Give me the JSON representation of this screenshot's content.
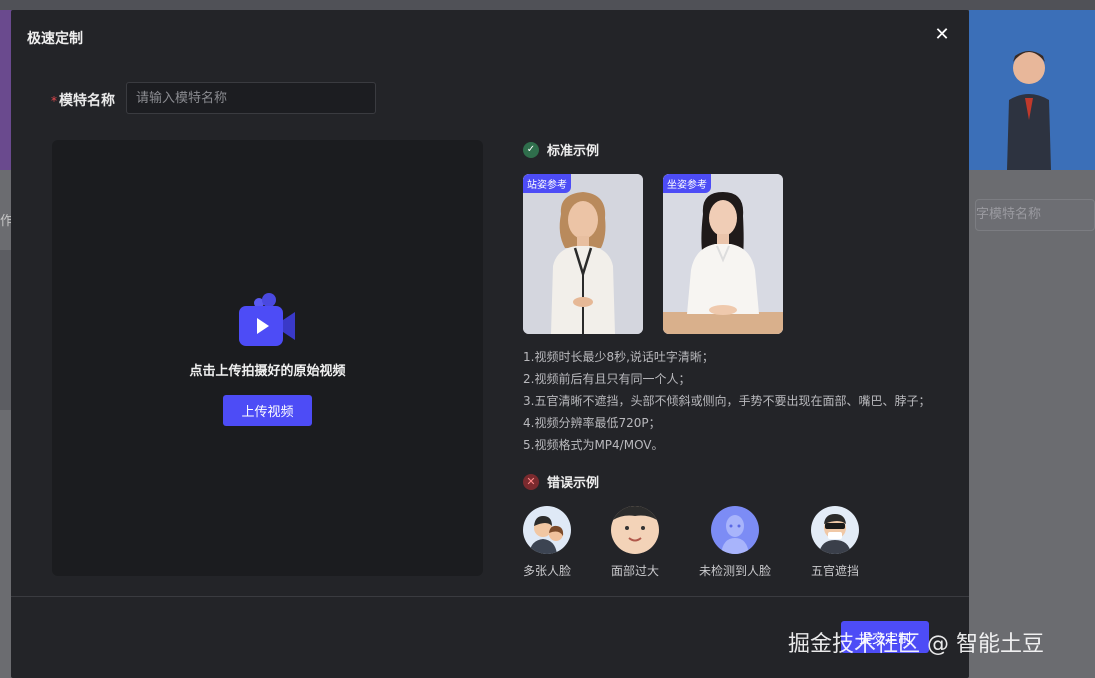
{
  "background": {
    "search_placeholder": "字模特名称",
    "left_text": "作"
  },
  "modal": {
    "title": "极速定制",
    "close_icon": "close-icon",
    "field": {
      "required_mark": "*",
      "label": "模特名称",
      "placeholder": "请输入模特名称",
      "value": ""
    },
    "upload": {
      "hint": "点击上传拍摄好的原始视频",
      "button": "上传视频",
      "icon": "video-camera-icon"
    },
    "standard": {
      "title": "标准示例",
      "samples": [
        {
          "tag": "站姿参考"
        },
        {
          "tag": "坐姿参考"
        }
      ],
      "rules": [
        "1.视频时长最少8秒,说话吐字清晰；",
        "2.视频前后有且只有同一个人；",
        "3.五官清晰不遮挡，头部不倾斜或侧向，手势不要出现在面部、嘴巴、脖子；",
        "4.视频分辨率最低720P；",
        "5.视频格式为MP4/MOV。"
      ]
    },
    "wrong": {
      "title": "错误示例",
      "items": [
        {
          "label": "多张人脸"
        },
        {
          "label": "面部过大"
        },
        {
          "label": "未检测到人脸"
        },
        {
          "label": "五官遮挡"
        }
      ]
    },
    "submit": "提交定制"
  },
  "watermark": "掘金技术社区 @ 智能土豆",
  "colors": {
    "accent": "#4d4cf6",
    "modal_bg": "#232428",
    "ok": "#2f6e4c",
    "error": "#7a2a2e"
  }
}
